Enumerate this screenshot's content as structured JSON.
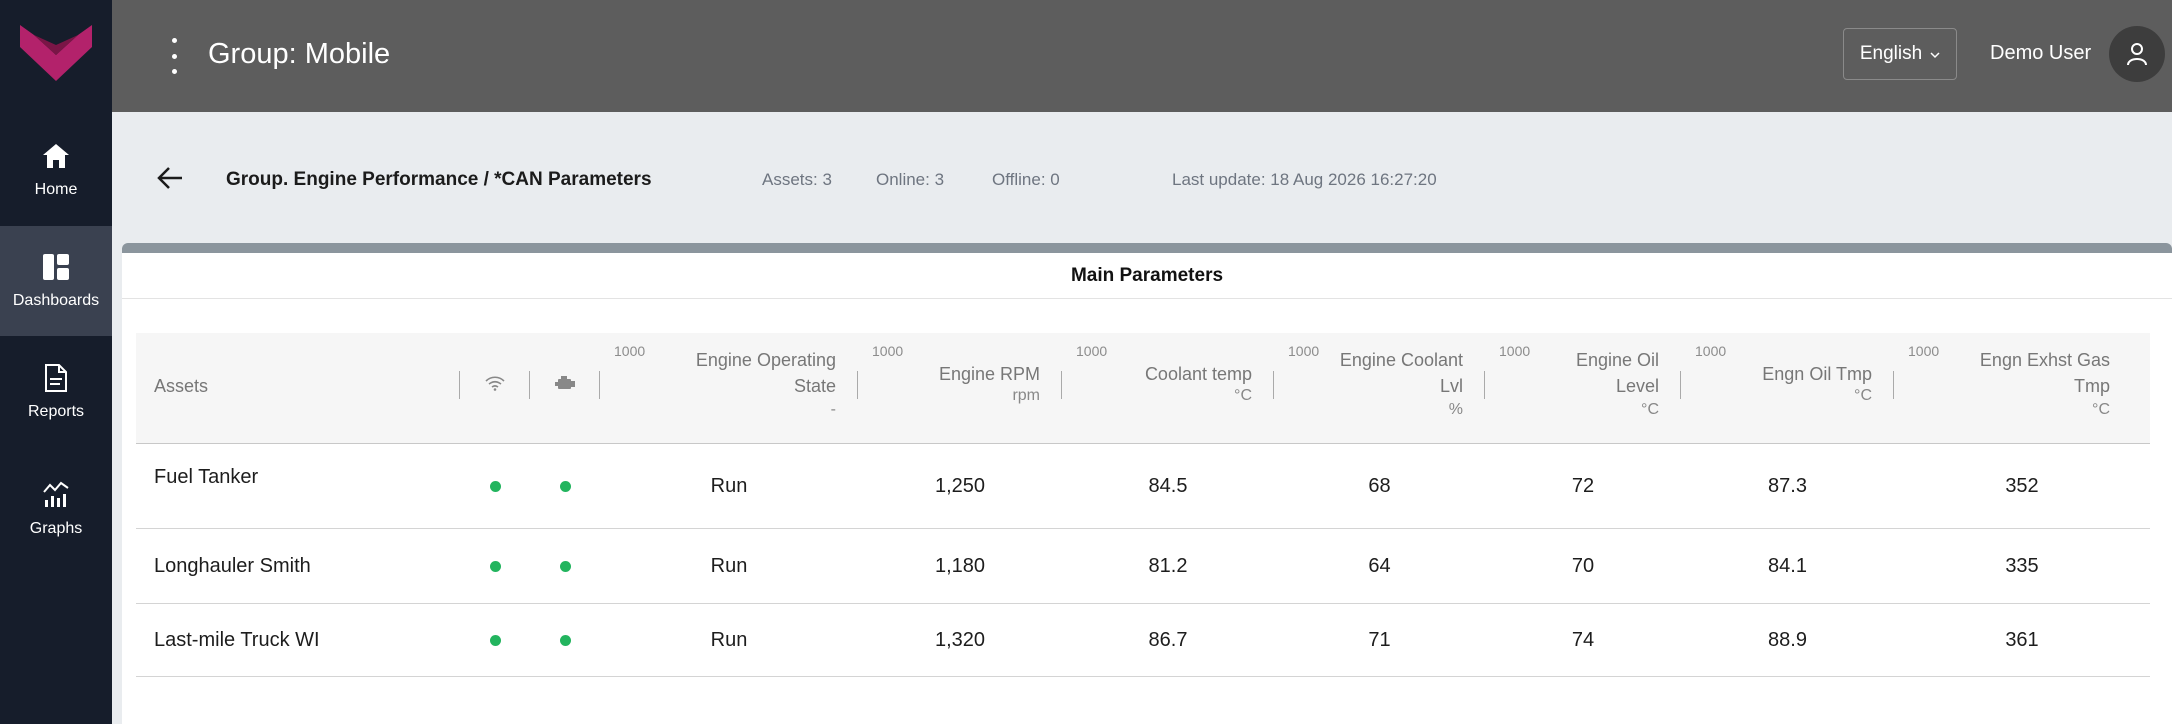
{
  "sidebar": {
    "items": [
      {
        "label": "Home",
        "icon": "home-icon"
      },
      {
        "label": "Dashboards",
        "icon": "dashboard-icon"
      },
      {
        "label": "Reports",
        "icon": "document-icon"
      },
      {
        "label": "Graphs",
        "icon": "graph-icon"
      }
    ]
  },
  "header": {
    "title": "Group: Mobile",
    "language": "English",
    "user": "Demo User"
  },
  "subheader": {
    "title": "Group. Engine Performance / *CAN Parameters",
    "assets": "Assets: 3",
    "online": "Online: 3",
    "offline": "Offline: 0",
    "last_update": "Last update: 18 Aug 2026 16:27:20"
  },
  "panel": {
    "title": "Main Parameters",
    "columns": [
      {
        "label": "Assets",
        "unit": "",
        "hint": ""
      },
      {
        "label": "",
        "icon": "wifi-icon"
      },
      {
        "label": "",
        "icon": "engine-icon"
      },
      {
        "label": "Engine Operating State",
        "unit": "-",
        "hint": "1000"
      },
      {
        "label": "Engine RPM",
        "unit": "rpm",
        "hint": "1000"
      },
      {
        "label": "Coolant temp",
        "unit": "°C",
        "hint": "1000"
      },
      {
        "label": "Engine Coolant Lvl",
        "unit": "%",
        "hint": "1000"
      },
      {
        "label": "Engine Oil Level",
        "unit": "°C",
        "hint": "1000"
      },
      {
        "label": "Engn Oil Tmp",
        "unit": "°C",
        "hint": "1000"
      },
      {
        "label": "Engn Exhst Gas Tmp",
        "unit": "°C",
        "hint": "1000"
      }
    ],
    "rows": [
      {
        "asset": "Fuel Tanker",
        "state": "Run",
        "rpm": "1,250",
        "coolant_temp": "84.5",
        "coolant_lvl": "68",
        "oil_level": "72",
        "oil_tmp": "87.3",
        "exhaust_tmp": "352"
      },
      {
        "asset": "Longhauler Smith",
        "state": "Run",
        "rpm": "1,180",
        "coolant_temp": "81.2",
        "coolant_lvl": "64",
        "oil_level": "70",
        "oil_tmp": "84.1",
        "exhaust_tmp": "335"
      },
      {
        "asset": "Last-mile Truck WI",
        "state": "Run",
        "rpm": "1,320",
        "coolant_temp": "86.7",
        "coolant_lvl": "71",
        "oil_level": "74",
        "oil_tmp": "88.9",
        "exhaust_tmp": "361"
      }
    ]
  },
  "colors": {
    "sidebar_bg": "#161d2b",
    "header_bg": "#5d5d5d",
    "status_online": "#22b45e",
    "logo_accent": "#b3226b"
  }
}
